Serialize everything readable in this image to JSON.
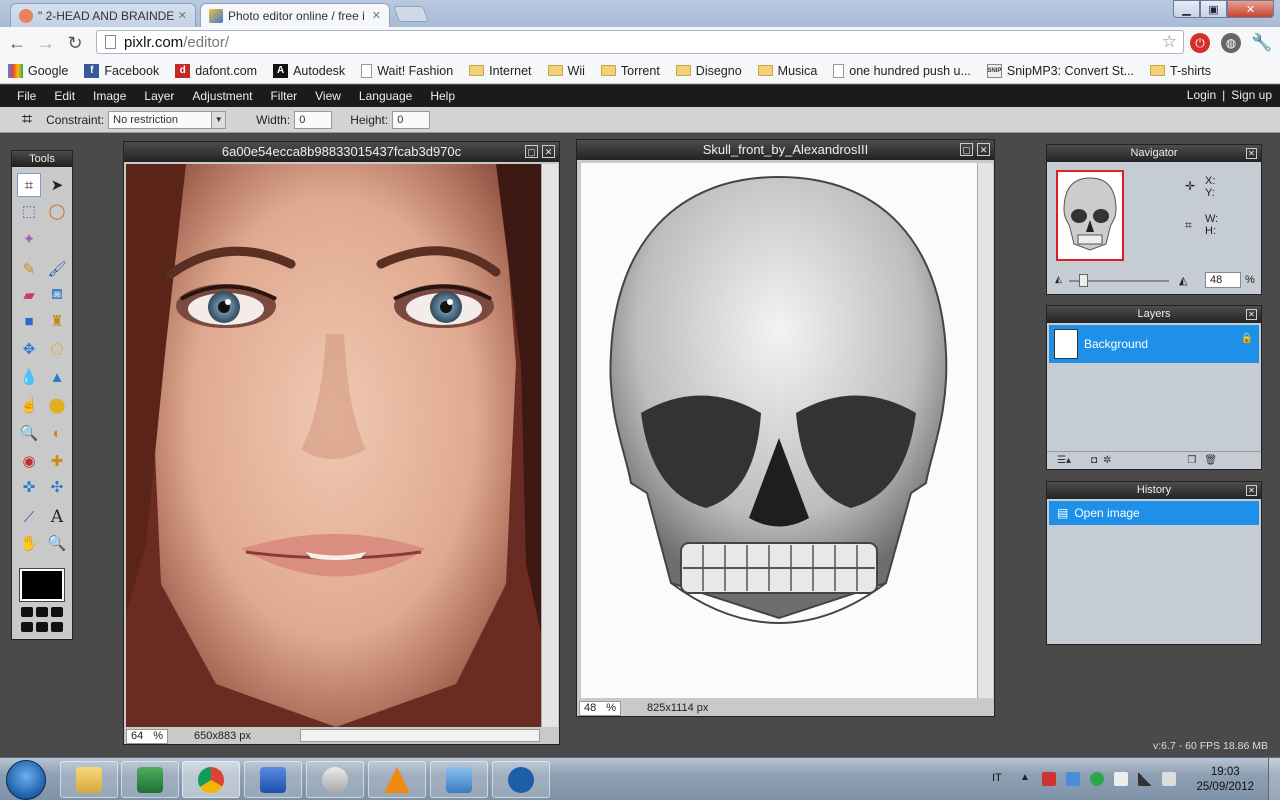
{
  "browser": {
    "tabs": [
      {
        "label": "\" 2-HEAD AND BRAINDEAD",
        "active": false
      },
      {
        "label": "Photo editor online / free i",
        "active": true
      }
    ],
    "address": {
      "host": "pixlr.com",
      "path": "/editor/"
    },
    "bookmarks": [
      {
        "label": "Google",
        "icon": "google-icon"
      },
      {
        "label": "Facebook",
        "icon": "facebook-icon"
      },
      {
        "label": "dafont.com",
        "icon": "dafont-icon"
      },
      {
        "label": "Autodesk",
        "icon": "autodesk-icon"
      },
      {
        "label": "Wait! Fashion",
        "icon": "page-icon"
      },
      {
        "label": "Internet",
        "icon": "folder-icon"
      },
      {
        "label": "Wii",
        "icon": "folder-icon"
      },
      {
        "label": "Torrent",
        "icon": "folder-icon"
      },
      {
        "label": "Disegno",
        "icon": "folder-icon"
      },
      {
        "label": "Musica",
        "icon": "folder-icon"
      },
      {
        "label": "one hundred push u...",
        "icon": "page-icon"
      },
      {
        "label": "SnipMP3: Convert St...",
        "icon": "snipmp3-icon"
      },
      {
        "label": "T-shirts",
        "icon": "folder-icon"
      }
    ]
  },
  "app": {
    "menu": [
      "File",
      "Edit",
      "Image",
      "Layer",
      "Adjustment",
      "Filter",
      "View",
      "Language",
      "Help"
    ],
    "login": "Login",
    "separator": "|",
    "signup": "Sign up",
    "options": {
      "constraint_label": "Constraint:",
      "constraint_value": "No restriction",
      "width_label": "Width:",
      "width_value": "0",
      "height_label": "Height:",
      "height_value": "0"
    },
    "tools_title": "Tools",
    "doc1": {
      "title": "6a00e54ecca8b98833015437fcab3d970c",
      "zoom": "64",
      "pct": "%",
      "size": "650x883 px"
    },
    "doc2": {
      "title": "Skull_front_by_AlexandrosIII",
      "zoom": "48",
      "pct": "%",
      "size": "825x1114 px"
    },
    "navigator": {
      "title": "Navigator",
      "x": "X:",
      "y": "Y:",
      "w": "W:",
      "h": "H:",
      "zoom": "48",
      "pct": "%"
    },
    "layers": {
      "title": "Layers",
      "items": [
        "Background"
      ]
    },
    "history": {
      "title": "History",
      "items": [
        "Open image"
      ]
    },
    "version": "v:6.7 - 60 FPS 18.86 MB"
  },
  "taskbar": {
    "lang": "IT",
    "time": "19:03",
    "date": "25/09/2012"
  },
  "colors": {
    "accent": "#1e90e8",
    "menubar": "#1b1b1b",
    "workspace": "#4a4a4a"
  }
}
